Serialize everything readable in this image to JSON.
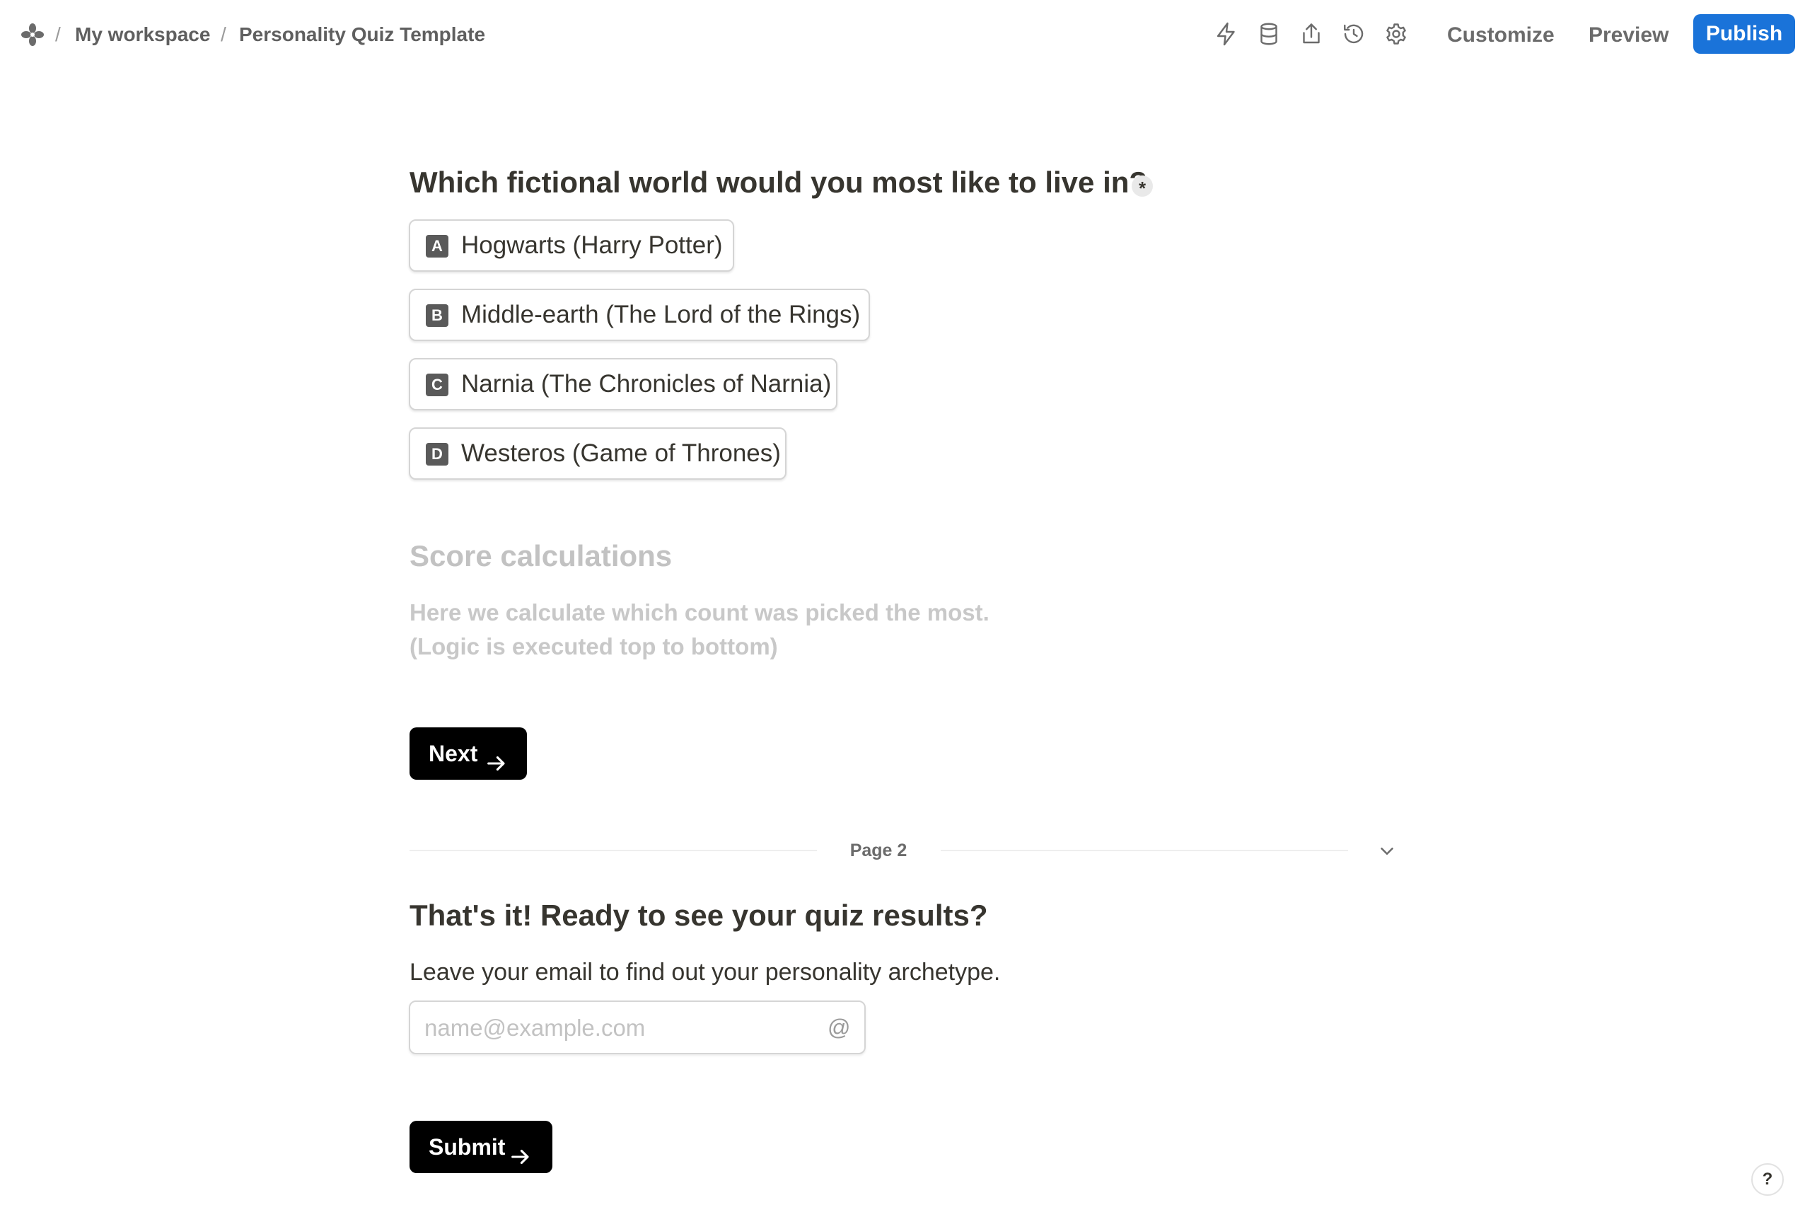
{
  "breadcrumb": {
    "separator": "/",
    "workspace": "My workspace",
    "form_name": "Personality Quiz Template"
  },
  "toolbar": {
    "icons": [
      "lightning-icon",
      "database-icon",
      "share-icon",
      "history-icon",
      "gear-icon"
    ],
    "customize_label": "Customize",
    "preview_label": "Preview",
    "publish_label": "Publish",
    "accent_color": "#1a73d9"
  },
  "question": {
    "title": "Which fictional world would you most like to live in?",
    "required_mark": "*",
    "options": [
      {
        "key": "A",
        "label": "Hogwarts (Harry Potter)"
      },
      {
        "key": "B",
        "label": "Middle-earth (The Lord of the Rings)"
      },
      {
        "key": "C",
        "label": "Narnia (The Chronicles of Narnia)"
      },
      {
        "key": "D",
        "label": "Westeros (Game of Thrones)"
      }
    ]
  },
  "score": {
    "title": "Score calculations",
    "line1": "Here we calculate which count was picked the most.",
    "line2": "(Logic is executed top to bottom)"
  },
  "next_button": {
    "label": "Next"
  },
  "page_divider": {
    "label": "Page 2"
  },
  "page2": {
    "title": "That's it! Ready to see your quiz results?",
    "description": "Leave your email to find out your personality archetype.",
    "email_placeholder": "name@example.com",
    "email_icon": "@"
  },
  "submit_button": {
    "label": "Submit"
  },
  "help": {
    "label": "?"
  }
}
